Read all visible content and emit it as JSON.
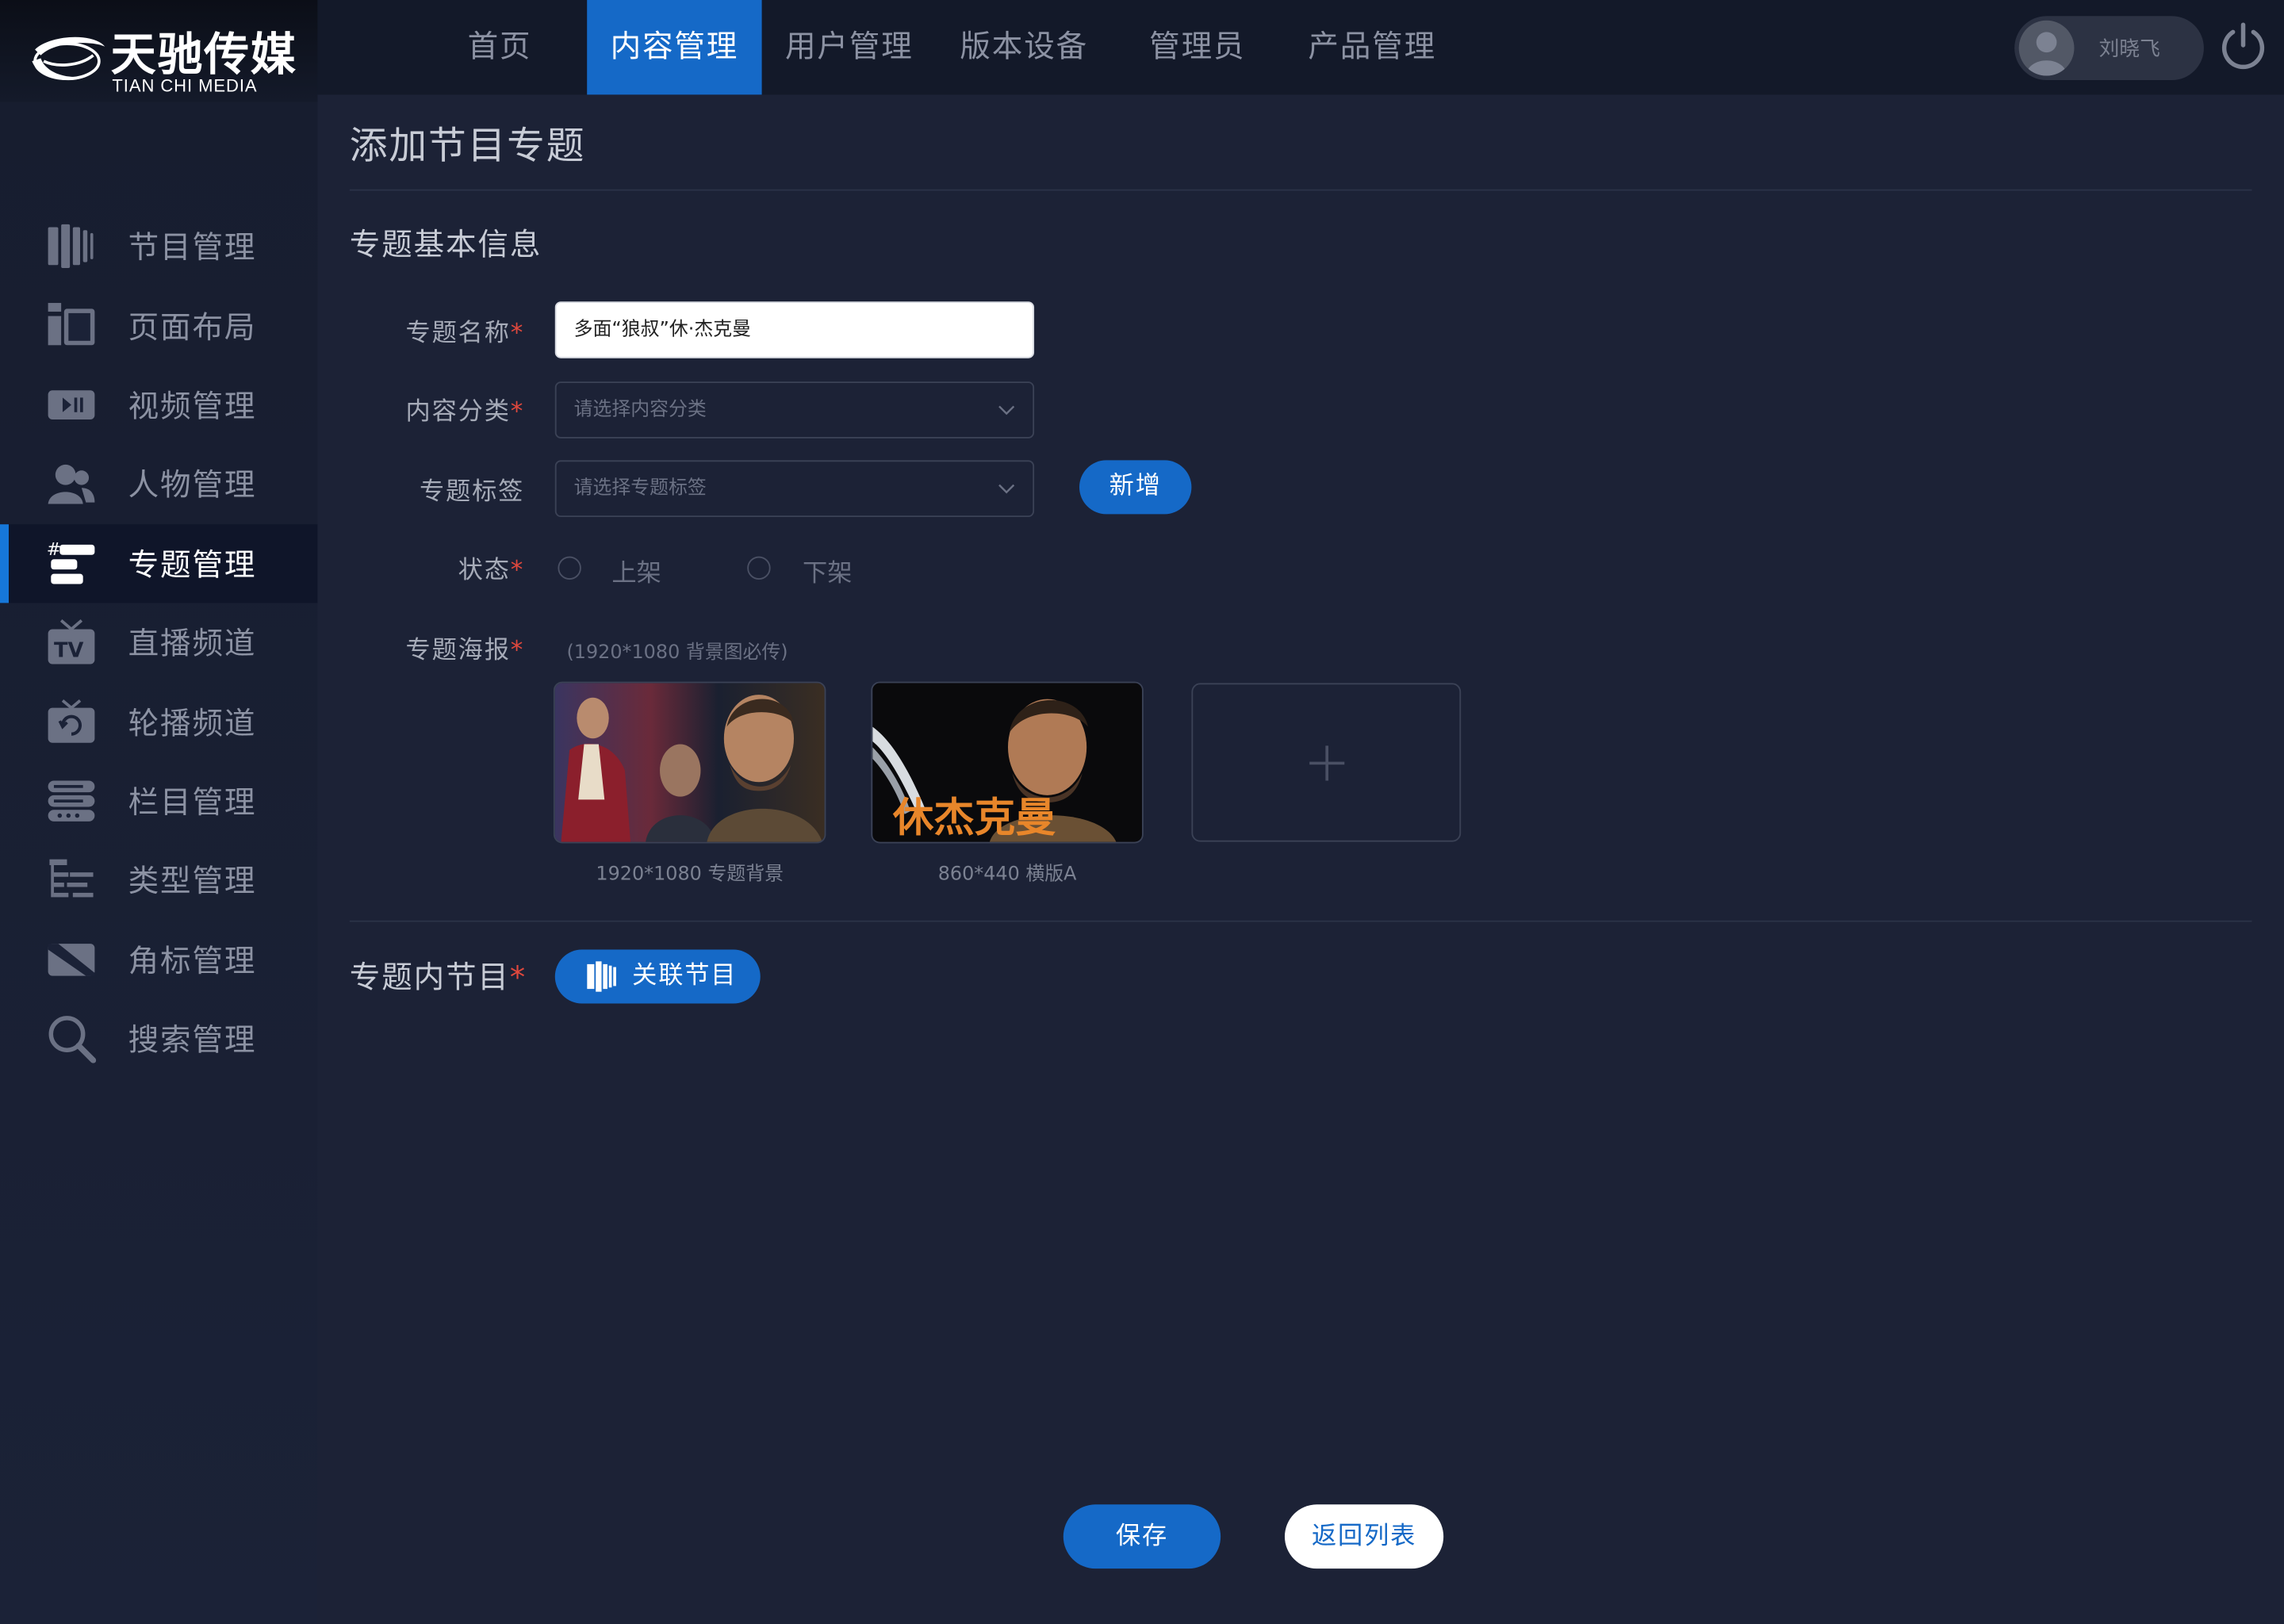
{
  "brand": {
    "name_cn": "天驰传媒",
    "name_en": "TIAN CHI MEDIA"
  },
  "topnav": {
    "tabs": [
      {
        "label": "首页",
        "active": false
      },
      {
        "label": "内容管理",
        "active": true
      },
      {
        "label": "用户管理",
        "active": false
      },
      {
        "label": "版本设备",
        "active": false
      },
      {
        "label": "管理员",
        "active": false
      },
      {
        "label": "产品管理",
        "active": false
      }
    ],
    "user_name": "刘晓飞"
  },
  "sidebar": {
    "items": [
      {
        "label": "节目管理",
        "icon": "program-icon",
        "active": false
      },
      {
        "label": "页面布局",
        "icon": "layout-icon",
        "active": false
      },
      {
        "label": "视频管理",
        "icon": "video-icon",
        "active": false
      },
      {
        "label": "人物管理",
        "icon": "people-icon",
        "active": false
      },
      {
        "label": "专题管理",
        "icon": "topic-icon",
        "active": true
      },
      {
        "label": "直播频道",
        "icon": "tv-icon",
        "active": false
      },
      {
        "label": "轮播频道",
        "icon": "carousel-icon",
        "active": false
      },
      {
        "label": "栏目管理",
        "icon": "column-icon",
        "active": false
      },
      {
        "label": "类型管理",
        "icon": "type-icon",
        "active": false
      },
      {
        "label": "角标管理",
        "icon": "badge-icon",
        "active": false
      },
      {
        "label": "搜索管理",
        "icon": "search-icon",
        "active": false
      }
    ]
  },
  "page": {
    "title": "添加节目专题",
    "section_basic": "专题基本信息",
    "form": {
      "name_label": "专题名称",
      "name_value": "多面“狼叔”休·杰克曼",
      "category_label": "内容分类",
      "category_placeholder": "请选择内容分类",
      "tag_label": "专题标签",
      "tag_placeholder": "请选择专题标签",
      "add_button": "新增",
      "status_label": "状态",
      "status_on": "上架",
      "status_off": "下架",
      "poster_label": "专题海报",
      "poster_hint": "(1920*1080 背景图必传)",
      "posters": [
        {
          "caption": "1920*1080 专题背景"
        },
        {
          "caption": "860*440 横版A",
          "overlay_text": "休杰克曼"
        }
      ],
      "required_mark": "*"
    },
    "section_programs": "专题内节目",
    "link_button": "关联节目",
    "save_button": "保存",
    "back_button": "返回列表"
  },
  "colors": {
    "accent": "#1569c7",
    "background": "#1c2236",
    "sidebar": "#171d2f",
    "required": "#e0483d"
  }
}
